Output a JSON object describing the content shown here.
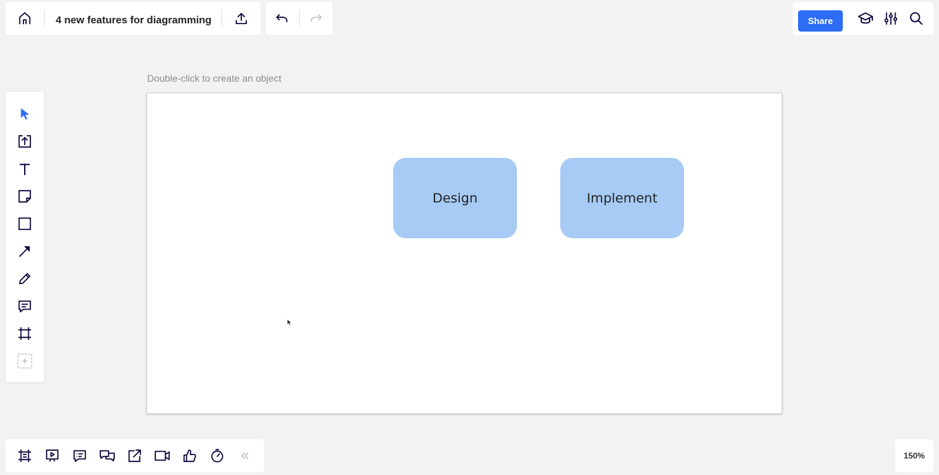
{
  "topbar": {
    "board_title": "4 new features for diagramming",
    "home_icon": "home-icon",
    "export_icon": "upload-icon",
    "undo_icon": "undo-icon",
    "redo_icon": "redo-icon",
    "redo_enabled": false
  },
  "right_toolbar": {
    "share_label": "Share",
    "icons": [
      "graduation-cap-icon",
      "sliders-icon",
      "search-icon"
    ]
  },
  "canvas": {
    "hint": "Double-click to create an object",
    "shapes": [
      {
        "label": "Design",
        "color": "#a7cbf4"
      },
      {
        "label": "Implement",
        "color": "#a7cbf4"
      }
    ]
  },
  "left_toolbar": {
    "tools": [
      {
        "name": "select",
        "icon": "cursor-arrow-icon",
        "active": true
      },
      {
        "name": "upload",
        "icon": "upload-box-icon"
      },
      {
        "name": "text",
        "icon": "text-icon"
      },
      {
        "name": "sticky-note",
        "icon": "sticky-note-icon"
      },
      {
        "name": "shape",
        "icon": "square-icon"
      },
      {
        "name": "connection-line",
        "icon": "arrow-line-icon"
      },
      {
        "name": "pen",
        "icon": "pen-icon"
      },
      {
        "name": "comment",
        "icon": "comment-icon"
      },
      {
        "name": "frame",
        "icon": "frame-icon"
      },
      {
        "name": "more",
        "icon": "plus-dashed-icon"
      }
    ]
  },
  "bottom_toolbar": {
    "icons": [
      "frames-icon",
      "presentation-icon",
      "comments-icon",
      "chat-icon",
      "share-screen-icon",
      "video-icon",
      "like-icon",
      "timer-icon",
      "collapse-icon"
    ]
  },
  "zoom": {
    "level": "150%"
  },
  "colors": {
    "accent": "#2d6df6",
    "shape_fill": "#a7cbf4",
    "background": "#f2f2f2"
  }
}
